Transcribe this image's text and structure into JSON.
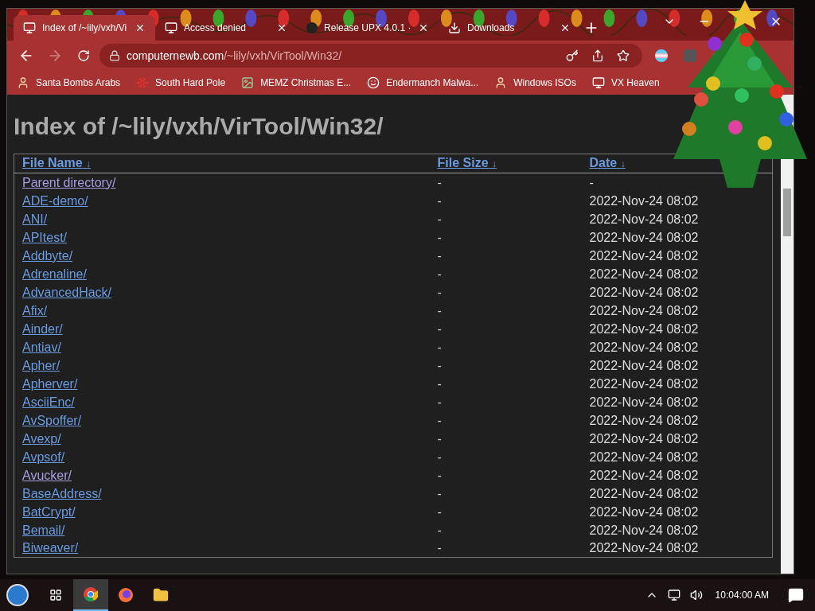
{
  "tabs": [
    {
      "title": "Index of /~lily/vxh/Vi",
      "selected": true,
      "kind": "computer"
    },
    {
      "title": "Access denied",
      "selected": false,
      "kind": "computer"
    },
    {
      "title": "Release UPX 4.0.1 ·",
      "selected": false,
      "kind": "github"
    },
    {
      "title": "Downloads",
      "selected": false,
      "kind": "download"
    }
  ],
  "address": {
    "host": "computernewb.com",
    "path": "/~lily/vxh/VirTool/Win32/"
  },
  "bookmarks": [
    {
      "title": "Santa Bombs Arabs",
      "kind": "figure"
    },
    {
      "title": "South Hard Pole",
      "kind": "star"
    },
    {
      "title": "MEMZ Christmas E...",
      "kind": "image"
    },
    {
      "title": "Endermanch Malwa...",
      "kind": "face"
    },
    {
      "title": "Windows ISOs",
      "kind": "figure"
    },
    {
      "title": "VX Heaven",
      "kind": "computer"
    }
  ],
  "page": {
    "heading": "Index of /~lily/vxh/VirTool/Win32/",
    "columns": [
      {
        "label": "File Name",
        "sort": "↓"
      },
      {
        "label": "File Size",
        "sort": "↓"
      },
      {
        "label": "Date",
        "sort": "↓"
      }
    ],
    "rows": [
      {
        "name": "Parent directory/",
        "size": "-",
        "date": "-",
        "visited": true
      },
      {
        "name": "ADE-demo/",
        "size": "-",
        "date": "2022-Nov-24 08:02",
        "visited": false
      },
      {
        "name": "ANI/",
        "size": "-",
        "date": "2022-Nov-24 08:02",
        "visited": false
      },
      {
        "name": "APItest/",
        "size": "-",
        "date": "2022-Nov-24 08:02",
        "visited": false
      },
      {
        "name": "Addbyte/",
        "size": "-",
        "date": "2022-Nov-24 08:02",
        "visited": false
      },
      {
        "name": "Adrenaline/",
        "size": "-",
        "date": "2022-Nov-24 08:02",
        "visited": false
      },
      {
        "name": "AdvancedHack/",
        "size": "-",
        "date": "2022-Nov-24 08:02",
        "visited": false
      },
      {
        "name": "Afix/",
        "size": "-",
        "date": "2022-Nov-24 08:02",
        "visited": false
      },
      {
        "name": "Ainder/",
        "size": "-",
        "date": "2022-Nov-24 08:02",
        "visited": false
      },
      {
        "name": "Antiav/",
        "size": "-",
        "date": "2022-Nov-24 08:02",
        "visited": false
      },
      {
        "name": "Apher/",
        "size": "-",
        "date": "2022-Nov-24 08:02",
        "visited": false
      },
      {
        "name": "Apherver/",
        "size": "-",
        "date": "2022-Nov-24 08:02",
        "visited": false
      },
      {
        "name": "AsciiEnc/",
        "size": "-",
        "date": "2022-Nov-24 08:02",
        "visited": false
      },
      {
        "name": "AvSpoffer/",
        "size": "-",
        "date": "2022-Nov-24 08:02",
        "visited": false
      },
      {
        "name": "Avexp/",
        "size": "-",
        "date": "2022-Nov-24 08:02",
        "visited": false
      },
      {
        "name": "Avpsof/",
        "size": "-",
        "date": "2022-Nov-24 08:02",
        "visited": false
      },
      {
        "name": "Avucker/",
        "size": "-",
        "date": "2022-Nov-24 08:02",
        "visited": true
      },
      {
        "name": "BaseAddress/",
        "size": "-",
        "date": "2022-Nov-24 08:02",
        "visited": false
      },
      {
        "name": "BatCrypt/",
        "size": "-",
        "date": "2022-Nov-24 08:02",
        "visited": false
      },
      {
        "name": "Bemail/",
        "size": "-",
        "date": "2022-Nov-24 08:02",
        "visited": false
      },
      {
        "name": "Biweaver/",
        "size": "-",
        "date": "2022-Nov-24 08:02",
        "visited": false
      }
    ]
  },
  "taskbar": {
    "apps": [
      {
        "kind": "taskview",
        "selected": false
      },
      {
        "kind": "chrome",
        "selected": true
      },
      {
        "kind": "firefox",
        "selected": false
      },
      {
        "kind": "explorer",
        "selected": false
      }
    ],
    "clock": "10:04:00 AM"
  }
}
